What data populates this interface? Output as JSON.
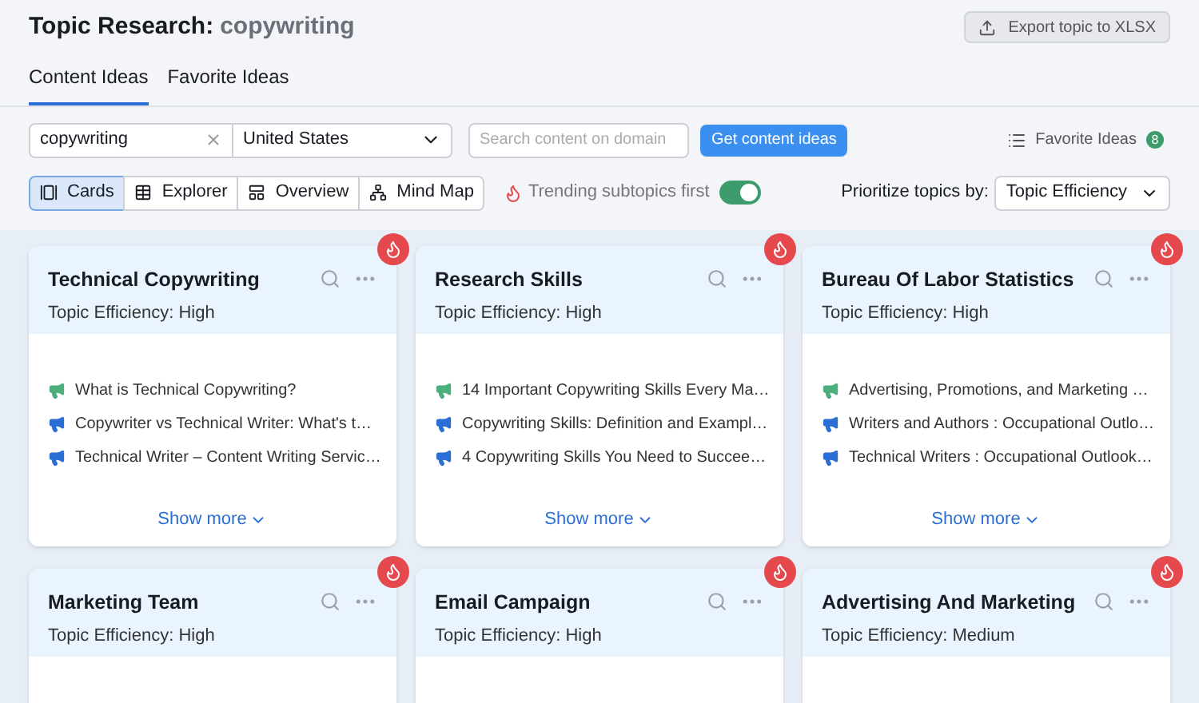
{
  "header": {
    "title": "Topic Research:",
    "keyword": "copywriting",
    "export_button": "Export topic to XLSX"
  },
  "tabs": [
    {
      "label": "Content Ideas",
      "selected": true
    },
    {
      "label": "Favorite Ideas",
      "selected": false
    }
  ],
  "filters": {
    "topic_value": "copywriting",
    "country": "United States",
    "domain_placeholder": "Search content on domain",
    "submit_button": "Get content ideas",
    "favorites_label": "Favorite Ideas",
    "favorites_count": "8"
  },
  "views": [
    {
      "label": "Cards",
      "selected": true
    },
    {
      "label": "Explorer",
      "selected": false
    },
    {
      "label": "Overview",
      "selected": false
    },
    {
      "label": "Mind Map",
      "selected": false
    }
  ],
  "trending_toggle": {
    "label": "Trending subtopics first",
    "on": true
  },
  "prioritize": {
    "label": "Prioritize topics by:",
    "value": "Topic Efficiency"
  },
  "cards": [
    {
      "title": "Technical Copywriting",
      "efficiency": "Topic Efficiency: High",
      "trending": true,
      "headlines": [
        {
          "text": "What is Technical Copywriting?",
          "color": "#4caf7d"
        },
        {
          "text": "Copywriter vs Technical Writer: What's t…",
          "color": "#2b6fd6"
        },
        {
          "text": "Technical Writer – Content Writing Servic…",
          "color": "#2b6fd6"
        }
      ],
      "show_more": "Show more"
    },
    {
      "title": "Research Skills",
      "efficiency": "Topic Efficiency: High",
      "trending": true,
      "headlines": [
        {
          "text": "14 Important Copywriting Skills Every Ma…",
          "color": "#4caf7d"
        },
        {
          "text": "Copywriting Skills: Definition and Exampl…",
          "color": "#2b6fd6"
        },
        {
          "text": "4 Copywriting Skills You Need to Succee…",
          "color": "#2b6fd6"
        }
      ],
      "show_more": "Show more"
    },
    {
      "title": "Bureau Of Labor Statistics",
      "efficiency": "Topic Efficiency: High",
      "trending": true,
      "headlines": [
        {
          "text": "Advertising, Promotions, and Marketing …",
          "color": "#4caf7d"
        },
        {
          "text": "Writers and Authors : Occupational Outlo…",
          "color": "#2b6fd6"
        },
        {
          "text": "Technical Writers : Occupational Outlook…",
          "color": "#2b6fd6"
        }
      ],
      "show_more": "Show more"
    },
    {
      "title": "Marketing Team",
      "efficiency": "Topic Efficiency: High",
      "trending": true
    },
    {
      "title": "Email Campaign",
      "efficiency": "Topic Efficiency: High",
      "trending": true
    },
    {
      "title": "Advertising And Marketing",
      "efficiency": "Topic Efficiency: Medium",
      "trending": true
    }
  ]
}
